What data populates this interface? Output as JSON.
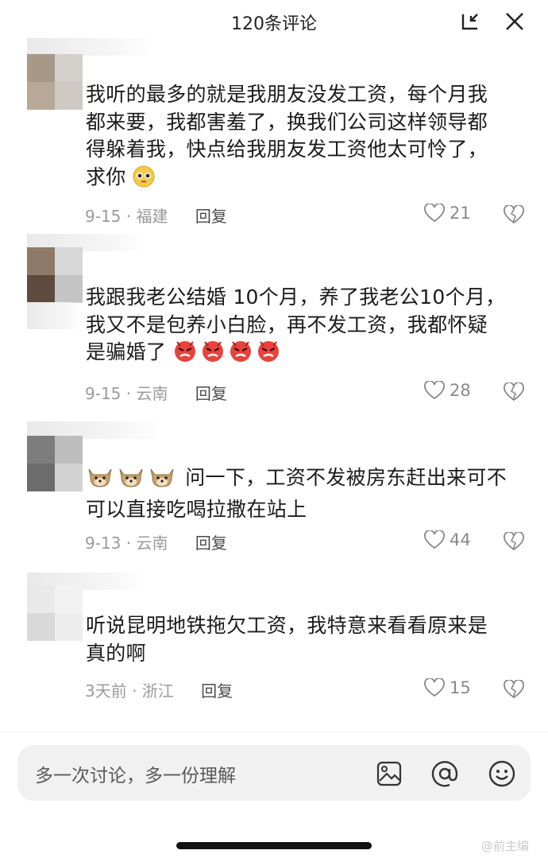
{
  "header": {
    "title": "120条评论"
  },
  "comments": [
    {
      "lines": [
        "我听的最多的就是我朋友没发工资，每个月我",
        "都来要，我都害羞了，换我们公司这样领导都",
        "得躲着我，快点给我朋友发工资他太可怜了，",
        "求你"
      ],
      "date": "9-15 · 福建",
      "reply": "回复",
      "likes": "21"
    },
    {
      "lines": [
        "我跟我老公结婚 10个月，养了我老公10个月，",
        "我又不是包养小白脸，再不发工资，我都怀疑",
        "是骗婚了"
      ],
      "date": "9-15 · 云南",
      "reply": "回复",
      "likes": "28"
    },
    {
      "lines": [
        "问一下，工资不发被房东赶出来可不",
        "可以直接吃喝拉撒在站上"
      ],
      "date": "9-13 · 云南",
      "reply": "回复",
      "likes": "44"
    },
    {
      "lines": [
        "听说昆明地铁拖欠工资，我特意来看看原来是",
        "真的啊"
      ],
      "date": "3天前 · 浙江",
      "reply": "回复",
      "likes": "15"
    }
  ],
  "input": {
    "placeholder": "多一次讨论，多一份理解"
  },
  "watermark": "@前主编",
  "icons": {
    "header": [
      "minimize-icon",
      "close-icon"
    ],
    "comment": [
      "heart-icon",
      "broken-heart-icon",
      "pleading-face-emoji",
      "angry-face-emoji",
      "doge-emoji"
    ],
    "input": [
      "image-icon",
      "at-icon",
      "smiley-icon"
    ]
  },
  "colors": {
    "meta": "#9a9a9a",
    "background": "#ffffff",
    "input_bg": "#f1f1f1"
  }
}
